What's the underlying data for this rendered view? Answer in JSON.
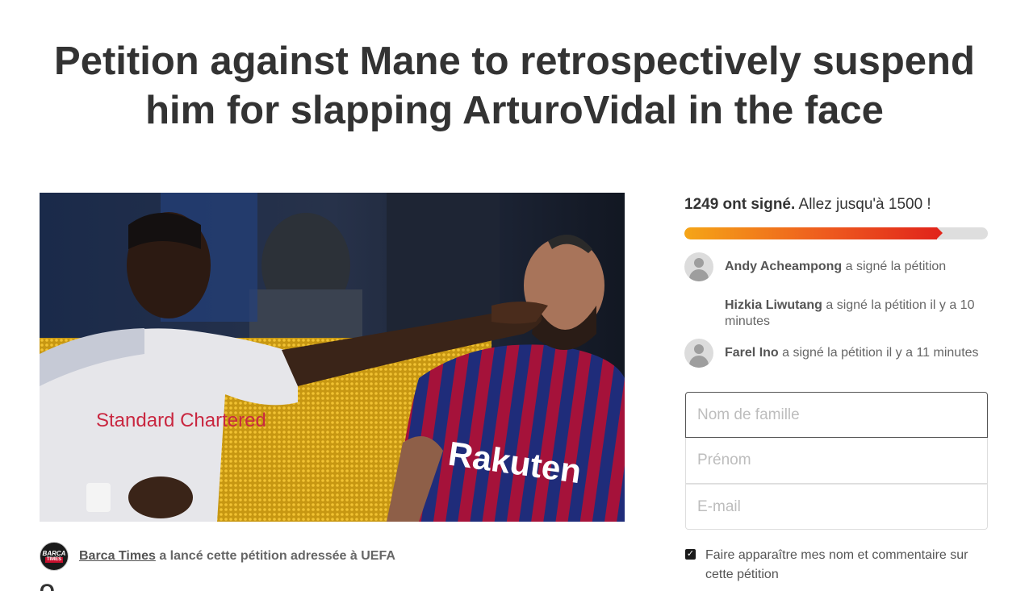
{
  "title_line1": "Petition against Mane to retrospectively suspend",
  "title_line2": "him for slapping ArturoVidal in the face",
  "media": {
    "sponsor_text": "Standard Chartered",
    "shirt_sponsor": "Rakuten"
  },
  "starter": {
    "avatar_line1": "BARCA",
    "avatar_line2": "TIMES",
    "name": "Barca Times",
    "text": "a lancé cette pétition adressée à UEFA"
  },
  "below_start": "Q",
  "progress": {
    "signed_count": "1249 ont signé.",
    "goal_text": "Allez jusqu'à 1500 !",
    "fraction": 0.8327,
    "colors": {
      "start": "#f5a517",
      "end": "#e1251b",
      "track": "#dedede"
    }
  },
  "signers": [
    {
      "name": "Andy Acheampong",
      "action": "a signé la pétition",
      "avatar": "user-icon"
    },
    {
      "name": "Hizkia Liwutang",
      "action": "a signé la pétition il y a 10 minutes",
      "avatar": ""
    },
    {
      "name": "Farel Ino",
      "action": "a signé la pétition il y a 11 minutes",
      "avatar": "user-icon"
    }
  ],
  "form": {
    "last_name_placeholder": "Nom de famille",
    "first_name_placeholder": "Prénom",
    "email_placeholder": "E-mail",
    "consent_label": "Faire apparaître mes nom et commentaire sur cette pétition",
    "consent_checked": true
  }
}
